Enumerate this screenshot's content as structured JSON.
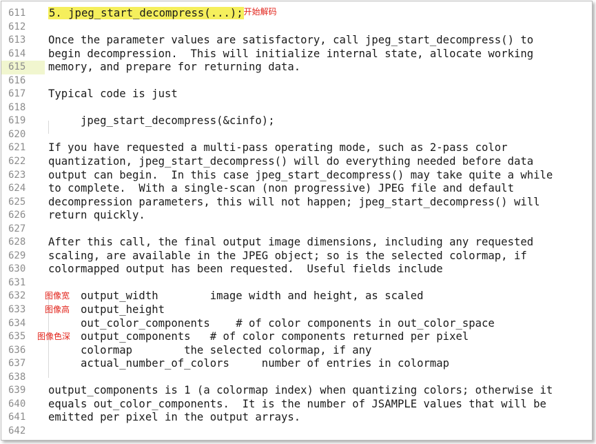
{
  "editor": {
    "current_line": "615",
    "lines": [
      {
        "num": "611",
        "text": "",
        "heading": "5. jpeg_start_decompress(...);",
        "note": "开始解码"
      },
      {
        "num": "612",
        "text": ""
      },
      {
        "num": "613",
        "text": "Once the parameter values are satisfactory, call jpeg_start_decompress() to"
      },
      {
        "num": "614",
        "text": "begin decompression.  This will initialize internal state, allocate working"
      },
      {
        "num": "615",
        "text": "memory, and prepare for returning data."
      },
      {
        "num": "616",
        "text": ""
      },
      {
        "num": "617",
        "text": "Typical code is just"
      },
      {
        "num": "618",
        "text": ""
      },
      {
        "num": "619",
        "text": "     jpeg_start_decompress(&cinfo);"
      },
      {
        "num": "620",
        "text": ""
      },
      {
        "num": "621",
        "text": "If you have requested a multi-pass operating mode, such as 2-pass color"
      },
      {
        "num": "622",
        "text": "quantization, jpeg_start_decompress() will do everything needed before data"
      },
      {
        "num": "623",
        "text": "output can begin.  In this case jpeg_start_decompress() may take quite a while"
      },
      {
        "num": "624",
        "text": "to complete.  With a single-scan (non progressive) JPEG file and default"
      },
      {
        "num": "625",
        "text": "decompression parameters, this will not happen; jpeg_start_decompress() will"
      },
      {
        "num": "626",
        "text": "return quickly."
      },
      {
        "num": "627",
        "text": ""
      },
      {
        "num": "628",
        "text": "After this call, the final output image dimensions, including any requested"
      },
      {
        "num": "629",
        "text": "scaling, are available in the JPEG object; so is the selected colormap, if"
      },
      {
        "num": "630",
        "text": "colormapped output has been requested.  Useful fields include"
      },
      {
        "num": "631",
        "text": ""
      },
      {
        "num": "632",
        "text": "     output_width        image width and height, as scaled",
        "sidenote": "图像宽"
      },
      {
        "num": "633",
        "text": "     output_height",
        "sidenote": "图像高"
      },
      {
        "num": "634",
        "text": "     out_color_components    # of color components in out_color_space"
      },
      {
        "num": "635",
        "text": "     output_components   # of color components returned per pixel",
        "sidenote": "图像色深"
      },
      {
        "num": "636",
        "text": "     colormap        the selected colormap, if any"
      },
      {
        "num": "637",
        "text": "     actual_number_of_colors     number of entries in colormap"
      },
      {
        "num": "638",
        "text": ""
      },
      {
        "num": "639",
        "text": "output_components is 1 (a colormap index) when quantizing colors; otherwise it"
      },
      {
        "num": "640",
        "text": "equals out_color_components.  It is the number of JSAMPLE values that will be"
      },
      {
        "num": "641",
        "text": "emitted per pixel in the output arrays."
      },
      {
        "num": "642",
        "text": ""
      }
    ]
  },
  "colors": {
    "heading_highlight": "#f5ef5c",
    "annotation": "#e2231a",
    "current_line_bg": "#f1f6cf",
    "line_number": "#8c8c8c"
  }
}
